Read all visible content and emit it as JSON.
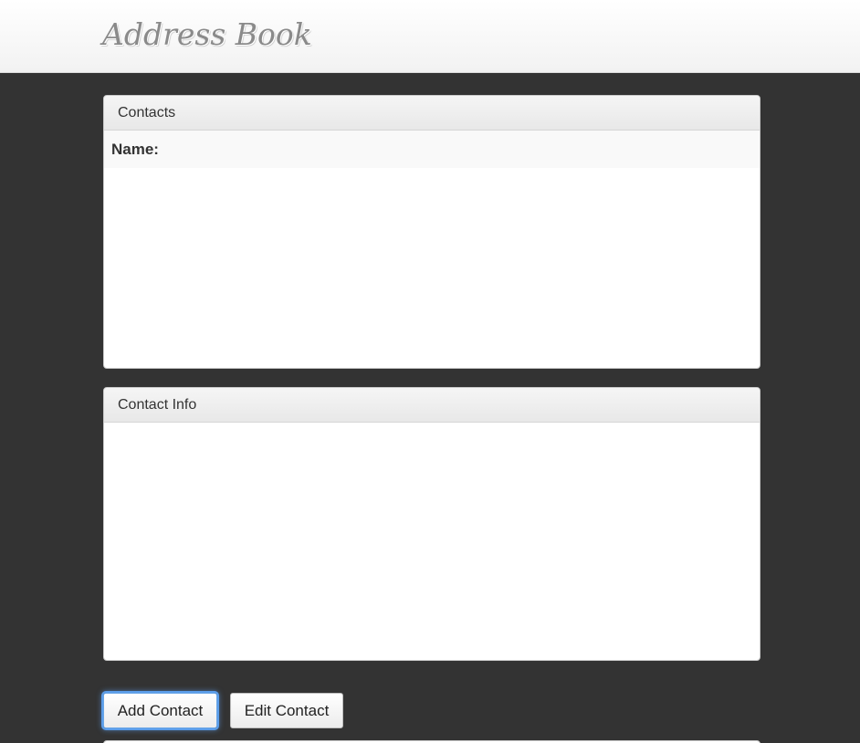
{
  "header": {
    "title": "Address Book"
  },
  "contacts_panel": {
    "heading": "Contacts",
    "name_label": "Name:"
  },
  "info_panel": {
    "heading": "Contact Info"
  },
  "actions": {
    "add_label": "Add Contact",
    "edit_label": "Edit Contact"
  },
  "colors": {
    "page_background": "#333333",
    "header_background": "#f7f7f7",
    "focus_ring": "#5b9dea"
  }
}
